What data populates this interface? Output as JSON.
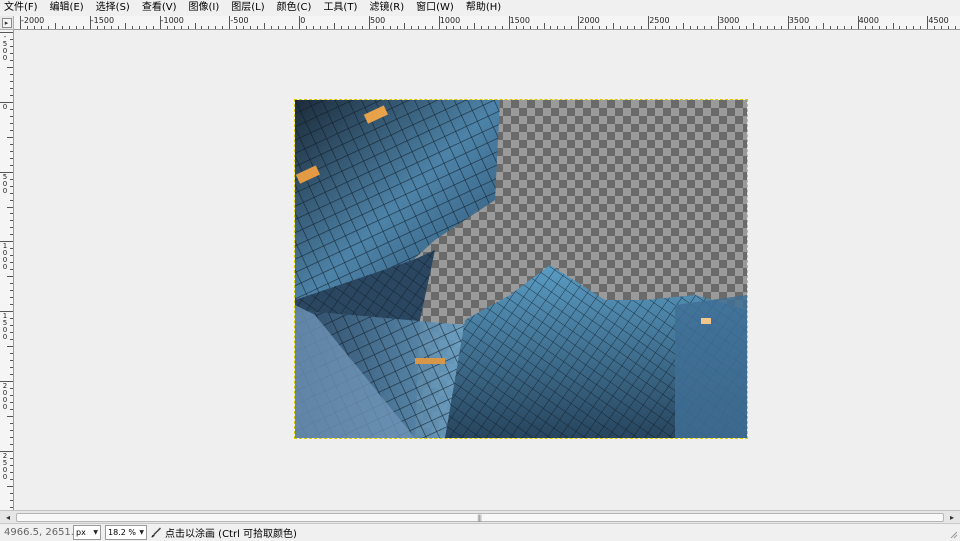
{
  "menu": [
    "文件(F)",
    "编辑(E)",
    "选择(S)",
    "查看(V)",
    "图像(I)",
    "图层(L)",
    "颜色(C)",
    "工具(T)",
    "滤镜(R)",
    "窗口(W)",
    "帮助(H)"
  ],
  "rulers": {
    "horizontal_labels": [
      "-2000",
      "-1500",
      "-1000",
      "-500",
      "0",
      "500",
      "1000",
      "1500",
      "2000",
      "2500",
      "3000",
      "3500",
      "4000",
      "4500"
    ],
    "vertical_labels": [
      "-500",
      "0",
      "500",
      "1000",
      "1500",
      "2000",
      "2500"
    ],
    "corner_icon": "nav-arrow-icon"
  },
  "canvas": {
    "background_color": "#efefef",
    "selection_border_color": "#d9c800",
    "checker_dark": "#6a6a6a",
    "checker_light": "#9a9a9a"
  },
  "statusbar": {
    "coordinates": "4966.5, 2651.0",
    "unit": "px",
    "zoom": "18.2 %",
    "hint": "点击以涂画 (Ctrl 可拾取颜色)",
    "tool_icon": "paintbrush-icon"
  }
}
